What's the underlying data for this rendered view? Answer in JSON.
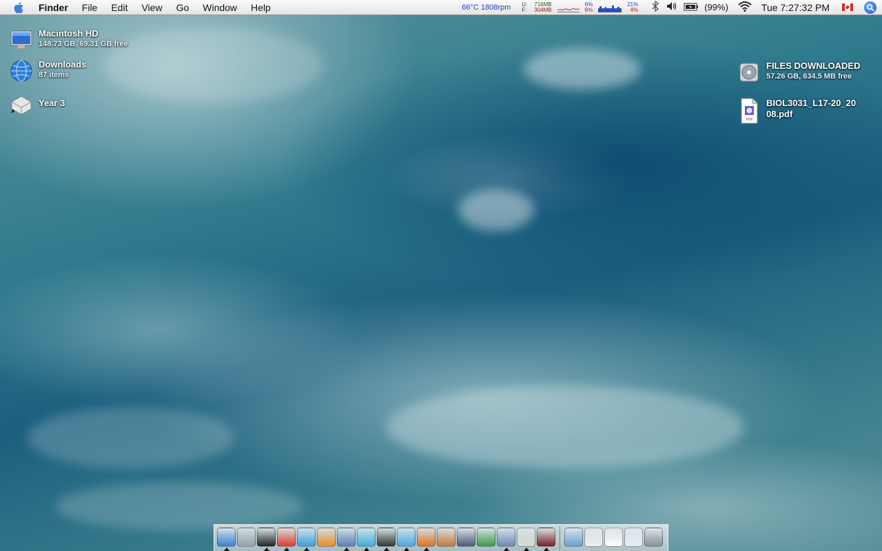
{
  "menubar": {
    "app_name": "Finder",
    "menus": [
      "File",
      "Edit",
      "View",
      "Go",
      "Window",
      "Help"
    ],
    "temp_fan": "66°C 1808rpm",
    "mem_labels": [
      "U:",
      "F:"
    ],
    "mem_used": "716MB",
    "mem_free": "304MB",
    "cpu1_user": "6%",
    "cpu1_sys": "6%",
    "cpu2_user": "21%",
    "cpu2_sys": "4%",
    "battery": "(99%)",
    "clock": "Tue 7:27:32 PM",
    "icons": [
      "apple-icon",
      "bluetooth-icon",
      "volume-icon",
      "battery-icon",
      "wifi-icon",
      "canada-flag-icon",
      "spotlight-icon"
    ],
    "colors": {
      "temp": "#1a3fc1",
      "spotlight": "#1d4fd0"
    }
  },
  "desktop": {
    "left_icons": [
      {
        "name": "Macintosh HD",
        "info": "148.73 GB, 69.31 GB free",
        "icon": "hard-drive-icon"
      },
      {
        "name": "Downloads",
        "info": "87 items",
        "icon": "downloads-folder-icon"
      },
      {
        "name": "Year 3",
        "info": "",
        "icon": "alias-drive-icon"
      }
    ],
    "right_icons": [
      {
        "name": "FILES DOWNLOADED",
        "info": "57.26 GB, 634.5 MB free",
        "icon": "disk-image-icon"
      },
      {
        "name_line1": "BIOL3031_L17-20_20",
        "name_line2": "08.pdf",
        "icon": "pdf-file-icon",
        "badge": "PDF"
      }
    ]
  },
  "dock": {
    "apps": [
      {
        "name": "finder-icon",
        "running": true,
        "color": "#3a7fd8"
      },
      {
        "name": "system-preferences-icon",
        "running": false,
        "color": "#9aa0a8"
      },
      {
        "name": "front-row-icon",
        "running": true,
        "color": "#222222"
      },
      {
        "name": "ical-icon",
        "running": true,
        "color": "#e03a2a"
      },
      {
        "name": "word-icon",
        "running": true,
        "color": "#3aa0e0"
      },
      {
        "name": "powerpoint-icon",
        "running": false,
        "color": "#f08a20"
      },
      {
        "name": "xcode-icon",
        "running": true,
        "color": "#5a7fb8"
      },
      {
        "name": "messenger-icon",
        "running": true,
        "color": "#3ab0e0"
      },
      {
        "name": "dvd-player-icon",
        "running": true,
        "color": "#333333"
      },
      {
        "name": "itunes-icon",
        "running": true,
        "color": "#4aa8e8"
      },
      {
        "name": "firefox-icon",
        "running": true,
        "color": "#e8701a"
      },
      {
        "name": "keynote-icon",
        "running": false,
        "color": "#c8783a"
      },
      {
        "name": "photoshop-icon",
        "running": false,
        "color": "#505878"
      },
      {
        "name": "excel-graph-icon",
        "running": false,
        "color": "#3a9a4a"
      },
      {
        "name": "iphoto-icon",
        "running": true,
        "color": "#6a8ab8"
      },
      {
        "name": "text-editor-icon",
        "running": true,
        "color": "#d8d8d0"
      },
      {
        "name": "photo-booth-icon",
        "running": true,
        "color": "#7a2020"
      }
    ],
    "docs": [
      {
        "name": "applications-folder-icon",
        "color": "#6aa0d8"
      },
      {
        "name": "screenshot-stack-icon",
        "color": "#f0f0f0"
      },
      {
        "name": "documents-stack-icon",
        "color": "#ffffff"
      },
      {
        "name": "downloads-stack-icon",
        "color": "#e8eef4"
      },
      {
        "name": "trash-icon",
        "color": "#8a9098"
      }
    ]
  }
}
